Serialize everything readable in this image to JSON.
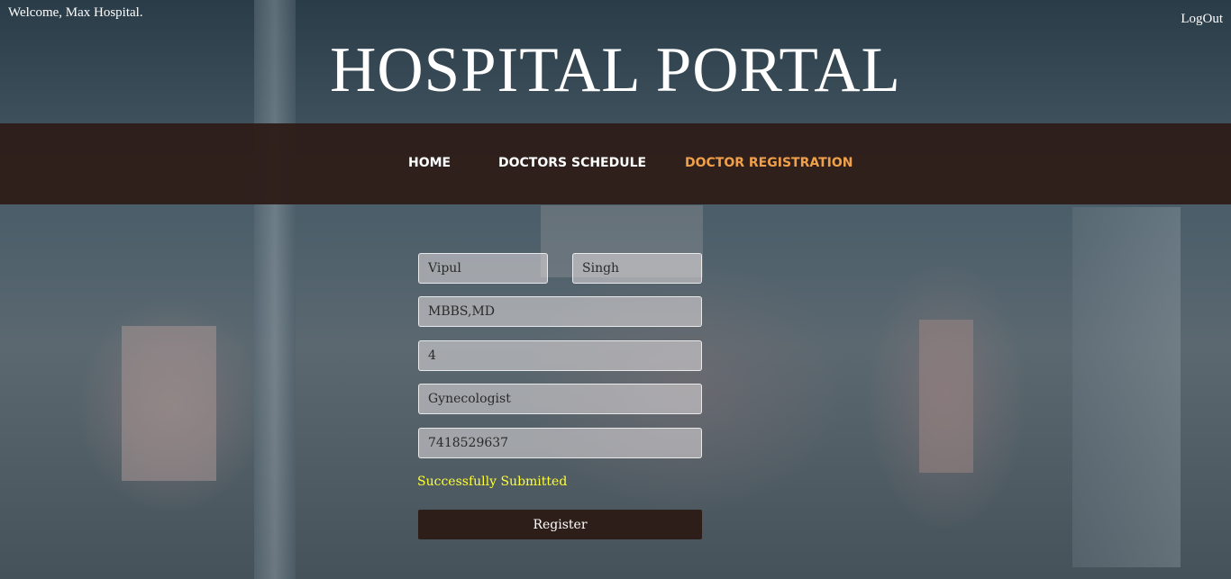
{
  "header": {
    "welcome_text": "Welcome, Max Hospital.",
    "logout_label": "LogOut",
    "title": "HOSPITAL PORTAL"
  },
  "nav": {
    "items": [
      {
        "label": "HOME",
        "active": false
      },
      {
        "label": "DOCTORS SCHEDULE",
        "active": false
      },
      {
        "label": "DOCTOR REGISTRATION",
        "active": true
      }
    ]
  },
  "form": {
    "first_name": "Vipul",
    "last_name": "Singh",
    "qualification": "MBBS,MD",
    "experience": "4",
    "specialization": "Gynecologist",
    "phone": "7418529637",
    "status_message": "Successfully Submitted",
    "submit_label": "Register"
  },
  "colors": {
    "nav_background": "#2e1e1a",
    "active_nav": "#f0a04b",
    "success_text": "#ffff33",
    "button_background": "#2e1e1a"
  }
}
